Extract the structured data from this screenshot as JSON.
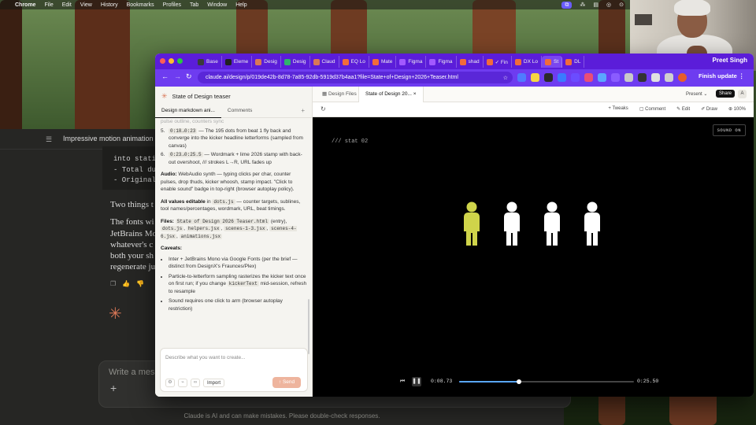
{
  "menubar": {
    "app": "Chrome",
    "items": [
      "File",
      "Edit",
      "View",
      "History",
      "Bookmarks",
      "Profiles",
      "Tab",
      "Window",
      "Help"
    ]
  },
  "background_app": {
    "title": "Impressive motion animation",
    "code_lines": [
      "into static",
      "- Total du",
      "- Original"
    ],
    "prose_lines": [
      "Two things t",
      "The fonts wi",
      "JetBrains Mo",
      "whatever's c",
      "both your sh",
      "regenerate ju"
    ],
    "composer_placeholder": "Write a mess",
    "disclaimer": "Claude is AI and can make mistakes. Please double-check responses."
  },
  "webcam": {
    "name": "Preet Singh"
  },
  "browser": {
    "tabs": [
      {
        "label": "Base",
        "color": "#3b3b3b"
      },
      {
        "label": "Eleme",
        "color": "#222222"
      },
      {
        "label": "Desig",
        "color": "#d97757"
      },
      {
        "label": "Desig",
        "color": "#2fb36b"
      },
      {
        "label": "Claud",
        "color": "#d97757"
      },
      {
        "label": "EQ Lo",
        "color": "#f26b3a"
      },
      {
        "label": "Mate",
        "color": "#f26b3a"
      },
      {
        "label": "Figma",
        "color": "#a259ff"
      },
      {
        "label": "Figma",
        "color": "#a259ff"
      },
      {
        "label": "shad",
        "color": "#f26b3a"
      },
      {
        "label": "✓ Fin",
        "color": "#f26b3a"
      },
      {
        "label": "DX Lo",
        "color": "#f26b3a"
      },
      {
        "label": "St",
        "color": "#f26b3a"
      },
      {
        "label": "DL",
        "color": "#f26b3a"
      }
    ],
    "url": "claude.ai/design/p/019de42b-8d78-7a85-92db-5919d37b4aa1?file=State+of+Design+2026+Teaser.html",
    "finish_update": "Finish update"
  },
  "left_panel": {
    "project_title": "State of Design teaser",
    "tabs": [
      "Design markdown ani...",
      "Comments"
    ],
    "faded_line": "pulse outline, counters sync",
    "steps": [
      {
        "n": "5.",
        "code": "0:18→0:23",
        "text": " — The 195 dots from beat 1 fly back and converge into the kicker headline letterforms (sampled from canvas)"
      },
      {
        "n": "6.",
        "code": "0:23→0:25.5",
        "text": " — Wordmark + lime 2026 stamp with back-out overshoot, /// strokes L→R, URL fades up"
      }
    ],
    "audio_label": "Audio:",
    "audio_text": " WebAudio synth — typing clicks per char, counter pulses, drop thuds, kicker whoosh, stamp impact. \"Click to enable sound\" badge in top-right (browser autoplay policy).",
    "editable_label": "All values editable",
    "editable_mid": " in ",
    "editable_code": "dots.js",
    "editable_text": " — counter targets, sublines, tool names/percentages, wordmark, URL, beat timings.",
    "files_label": "Files:",
    "files": [
      "State of Design 2026 Teaser.html",
      "dots.js",
      "helpers.jsx",
      "scenes-1-3.jsx",
      "scenes-4-6.jsx",
      "animations.jsx"
    ],
    "files_entry_note": " (entry), ",
    "caveats_label": "Caveats:",
    "caveat1": "Inter + JetBrains Mono via Google Fonts (per the brief — distinct from DesignX's Fraunces/Plex)",
    "caveat2_pre": "Particle-to-letterform sampling rasterizes the kicker text once on first run; if you change ",
    "caveat2_code": "kickerText",
    "caveat2_post": " mid-session, refresh to resample",
    "caveat3": "Sound requires one click to arm (browser autoplay restriction)",
    "composer_placeholder": "Describe what you want to create...",
    "import_label": "Import",
    "send_label": "Send"
  },
  "right_panel": {
    "file_tabs": [
      "Design Files",
      "State of Design 20..."
    ],
    "present_label": "Present",
    "share_label": "Share",
    "avatar_letter": "A",
    "tools": [
      "+ Tweaks",
      "Comment",
      "Edit",
      "Draw",
      "100%"
    ],
    "stat_label": "/// stat 02",
    "sound_badge": "SOUND ON",
    "figures": [
      {
        "color": "#cfd44a"
      },
      {
        "color": "#ffffff"
      },
      {
        "color": "#ffffff"
      },
      {
        "color": "#ffffff"
      }
    ],
    "current_time": "0:08.73",
    "total_time": "0:25.50",
    "progress": 0.342
  }
}
